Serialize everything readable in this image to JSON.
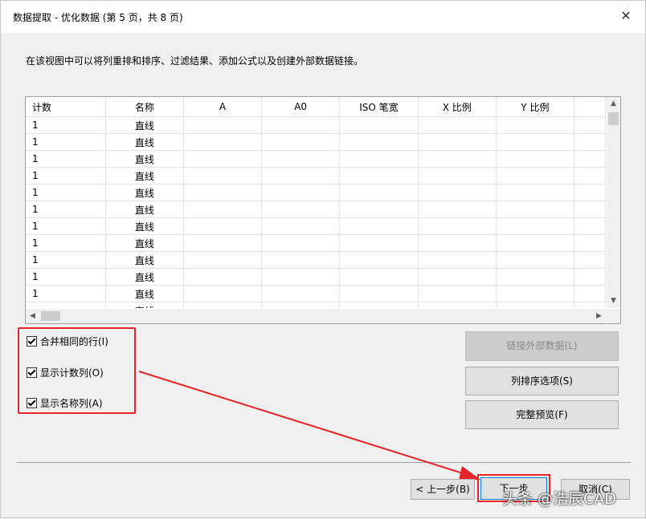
{
  "window": {
    "title": "数据提取 - 优化数据 (第 5 页，共 8 页)",
    "close_glyph": "✕"
  },
  "description": "在该视图中可以将列重排和排序、过滤结果、添加公式以及创建外部数据链接。",
  "table": {
    "columns": [
      "计数",
      "名称",
      "A",
      "A0",
      "ISO 笔宽",
      "X 比例",
      "Y 比例"
    ],
    "rows": [
      [
        "1",
        "直线"
      ],
      [
        "1",
        "直线"
      ],
      [
        "1",
        "直线"
      ],
      [
        "1",
        "直线"
      ],
      [
        "1",
        "直线"
      ],
      [
        "1",
        "直线"
      ],
      [
        "1",
        "直线"
      ],
      [
        "1",
        "直线"
      ],
      [
        "1",
        "直线"
      ],
      [
        "1",
        "直线"
      ],
      [
        "1",
        "直线"
      ],
      [
        "",
        "直线"
      ]
    ]
  },
  "options": {
    "merge_rows": "合并相同的行(I)",
    "show_count": "显示计数列(O)",
    "show_name": "显示名称列(A)"
  },
  "buttons": {
    "link_external": "链接外部数据(L)",
    "column_sort": "列排序选项(S)",
    "full_preview": "完整预览(F)",
    "back": "< 上一步(B)",
    "next": "下一步",
    "cancel": "取消(C)"
  },
  "watermark": "头条 @浩辰CAD",
  "accent_colors": {
    "highlight_red": "#e8232a"
  }
}
